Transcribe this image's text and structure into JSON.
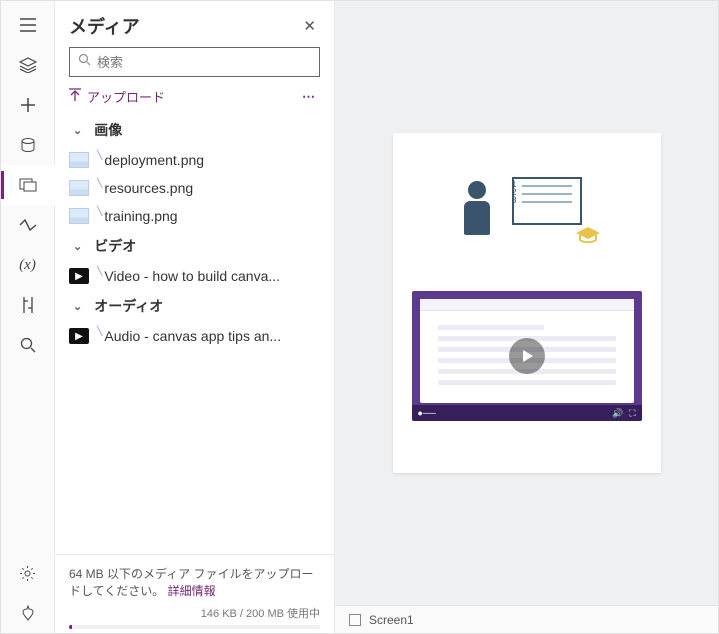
{
  "panel": {
    "title": "メディア",
    "search_placeholder": "検索",
    "upload_label": "アップロード"
  },
  "categories": {
    "images": "画像",
    "video": "ビデオ",
    "audio": "オーディオ"
  },
  "items": {
    "img0": "deployment.png",
    "img1": "resources.png",
    "img2": "training.png",
    "vid0": "Video - how to build canva...",
    "aud0": "Audio - canvas app tips an..."
  },
  "footer": {
    "msg_a": "64 MB 以下のメディア ファイルをアップロードしてください。",
    "link": "詳細情報",
    "usage": "146 KB / 200 MB 使用中"
  },
  "canvas": {
    "screen_name": "Screen1"
  }
}
